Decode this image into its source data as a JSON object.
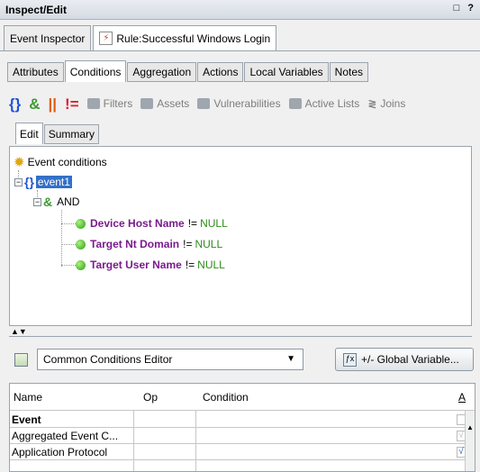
{
  "window": {
    "title": "Inspect/Edit",
    "controls": "□ ?"
  },
  "doc_tabs": [
    {
      "label": "Event Inspector"
    },
    {
      "label": "Rule:Successful Windows Login"
    }
  ],
  "sub_tabs": [
    {
      "label": "Attributes"
    },
    {
      "label": "Conditions"
    },
    {
      "label": "Aggregation"
    },
    {
      "label": "Actions"
    },
    {
      "label": "Local Variables"
    },
    {
      "label": "Notes"
    }
  ],
  "toolbar": {
    "braces": "{}",
    "and": "&",
    "or": "||",
    "not": "!=",
    "filters": "Filters",
    "assets": "Assets",
    "vulnerabilities": "Vulnerabilities",
    "active_lists": "Active Lists",
    "joins": "Joins"
  },
  "editor_tabs": [
    {
      "label": "Edit"
    },
    {
      "label": "Summary"
    }
  ],
  "tree": {
    "root": "Event conditions",
    "event": "event1",
    "and": "AND",
    "conditions": [
      {
        "field": "Device Host Name",
        "op": "!=",
        "value": "NULL"
      },
      {
        "field": "Target Nt Domain",
        "op": "!=",
        "value": "NULL"
      },
      {
        "field": "Target User Name",
        "op": "!=",
        "value": "NULL"
      }
    ]
  },
  "editor_select": {
    "value": "Common Conditions Editor"
  },
  "global_variable_button": "+/- Global Variable...",
  "table": {
    "headers": {
      "name": "Name",
      "op": "Op",
      "condition": "Condition",
      "extra": "A"
    },
    "rows": [
      {
        "name": "Event",
        "op": "",
        "condition": "",
        "check": ""
      },
      {
        "name": "Aggregated Event C...",
        "op": "",
        "condition": "",
        "check": "√"
      },
      {
        "name": "Application Protocol",
        "op": "",
        "condition": "",
        "check": "√"
      }
    ]
  }
}
